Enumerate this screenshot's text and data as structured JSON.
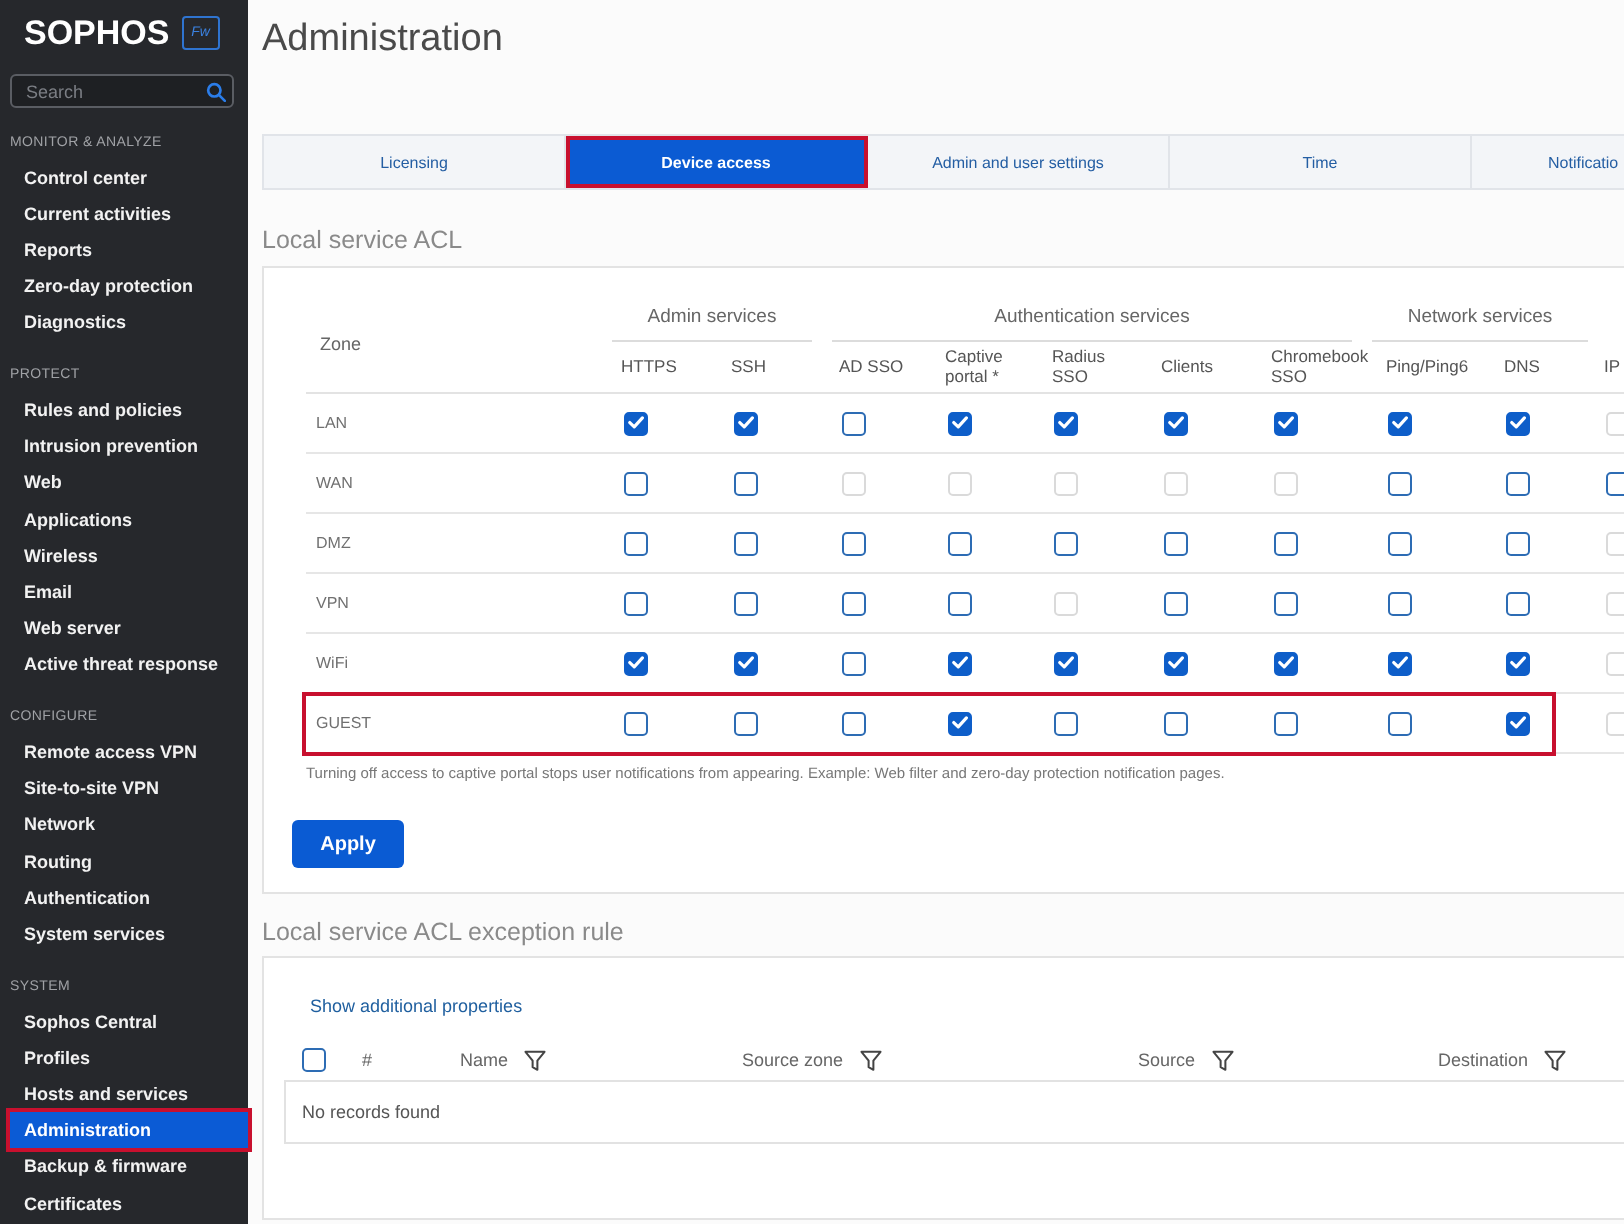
{
  "sidebar": {
    "logo": "SOPHOS",
    "badge": "Fw",
    "search": {
      "placeholder": "Search"
    },
    "sections": [
      {
        "title": "MONITOR & ANALYZE",
        "items": [
          {
            "label": "Control center",
            "selected": false,
            "highlighted": false
          },
          {
            "label": "Current activities",
            "selected": false,
            "highlighted": false
          },
          {
            "label": "Reports",
            "selected": false,
            "highlighted": false
          },
          {
            "label": "Zero-day protection",
            "selected": false,
            "highlighted": false
          },
          {
            "label": "Diagnostics",
            "selected": false,
            "highlighted": false
          }
        ]
      },
      {
        "title": "PROTECT",
        "items": [
          {
            "label": "Rules and policies",
            "selected": false,
            "highlighted": false
          },
          {
            "label": "Intrusion prevention",
            "selected": false,
            "highlighted": false
          },
          {
            "label": "Web",
            "selected": false,
            "highlighted": false
          },
          {
            "label": "Applications",
            "selected": false,
            "highlighted": false
          },
          {
            "label": "Wireless",
            "selected": false,
            "highlighted": false
          },
          {
            "label": "Email",
            "selected": false,
            "highlighted": false
          },
          {
            "label": "Web server",
            "selected": false,
            "highlighted": false
          },
          {
            "label": "Active threat response",
            "selected": false,
            "highlighted": false
          }
        ]
      },
      {
        "title": "CONFIGURE",
        "items": [
          {
            "label": "Remote access VPN",
            "selected": false,
            "highlighted": false
          },
          {
            "label": "Site-to-site VPN",
            "selected": false,
            "highlighted": false
          },
          {
            "label": "Network",
            "selected": false,
            "highlighted": false
          },
          {
            "label": "Routing",
            "selected": false,
            "highlighted": false
          },
          {
            "label": "Authentication",
            "selected": false,
            "highlighted": false
          },
          {
            "label": "System services",
            "selected": false,
            "highlighted": false
          }
        ]
      },
      {
        "title": "SYSTEM",
        "items": [
          {
            "label": "Sophos Central",
            "selected": false,
            "highlighted": false
          },
          {
            "label": "Profiles",
            "selected": false,
            "highlighted": false
          },
          {
            "label": "Hosts and services",
            "selected": false,
            "highlighted": false
          },
          {
            "label": "Administration",
            "selected": true,
            "highlighted": true
          },
          {
            "label": "Backup & firmware",
            "selected": false,
            "highlighted": false
          },
          {
            "label": "Certificates",
            "selected": false,
            "highlighted": false
          }
        ]
      }
    ]
  },
  "page_title": "Administration",
  "tabs": [
    {
      "label": "Licensing",
      "selected": false,
      "highlighted": false
    },
    {
      "label": "Device access",
      "selected": true,
      "highlighted": true
    },
    {
      "label": "Admin and user settings",
      "selected": false,
      "highlighted": false
    },
    {
      "label": "Time",
      "selected": false,
      "highlighted": false
    },
    {
      "label": "Notificatio",
      "selected": false,
      "highlighted": false
    }
  ],
  "acl": {
    "title": "Local service ACL",
    "zone_header": "Zone",
    "groups": [
      {
        "label": "Admin services",
        "columns": [
          "HTTPS",
          "SSH"
        ]
      },
      {
        "label": "Authentication services",
        "columns": [
          "AD SSO",
          "Captive portal *",
          "Radius SSO",
          "Clients",
          "Chromebook SSO"
        ]
      },
      {
        "label": "Network services",
        "columns": [
          "Ping/Ping6",
          "DNS"
        ]
      },
      {
        "columns": [
          "IP"
        ]
      }
    ],
    "zones": [
      {
        "name": "LAN",
        "highlighted": false,
        "cells": [
          {
            "checked": true,
            "disabled": false
          },
          {
            "checked": true,
            "disabled": false
          },
          {
            "checked": false,
            "disabled": false
          },
          {
            "checked": true,
            "disabled": false
          },
          {
            "checked": true,
            "disabled": false
          },
          {
            "checked": true,
            "disabled": false
          },
          {
            "checked": true,
            "disabled": false
          },
          {
            "checked": true,
            "disabled": false
          },
          {
            "checked": true,
            "disabled": false
          },
          {
            "checked": false,
            "disabled": true
          }
        ]
      },
      {
        "name": "WAN",
        "highlighted": false,
        "cells": [
          {
            "checked": false,
            "disabled": false
          },
          {
            "checked": false,
            "disabled": false
          },
          {
            "checked": false,
            "disabled": true
          },
          {
            "checked": false,
            "disabled": true
          },
          {
            "checked": false,
            "disabled": true
          },
          {
            "checked": false,
            "disabled": true
          },
          {
            "checked": false,
            "disabled": true
          },
          {
            "checked": false,
            "disabled": false
          },
          {
            "checked": false,
            "disabled": false
          },
          {
            "checked": false,
            "disabled": false
          }
        ]
      },
      {
        "name": "DMZ",
        "highlighted": false,
        "cells": [
          {
            "checked": false,
            "disabled": false
          },
          {
            "checked": false,
            "disabled": false
          },
          {
            "checked": false,
            "disabled": false
          },
          {
            "checked": false,
            "disabled": false
          },
          {
            "checked": false,
            "disabled": false
          },
          {
            "checked": false,
            "disabled": false
          },
          {
            "checked": false,
            "disabled": false
          },
          {
            "checked": false,
            "disabled": false
          },
          {
            "checked": false,
            "disabled": false
          },
          {
            "checked": false,
            "disabled": true
          }
        ]
      },
      {
        "name": "VPN",
        "highlighted": false,
        "cells": [
          {
            "checked": false,
            "disabled": false
          },
          {
            "checked": false,
            "disabled": false
          },
          {
            "checked": false,
            "disabled": false
          },
          {
            "checked": false,
            "disabled": false
          },
          {
            "checked": false,
            "disabled": true
          },
          {
            "checked": false,
            "disabled": false
          },
          {
            "checked": false,
            "disabled": false
          },
          {
            "checked": false,
            "disabled": false
          },
          {
            "checked": false,
            "disabled": false
          },
          {
            "checked": false,
            "disabled": true
          }
        ]
      },
      {
        "name": "WiFi",
        "highlighted": false,
        "cells": [
          {
            "checked": true,
            "disabled": false
          },
          {
            "checked": true,
            "disabled": false
          },
          {
            "checked": false,
            "disabled": false
          },
          {
            "checked": true,
            "disabled": false
          },
          {
            "checked": true,
            "disabled": false
          },
          {
            "checked": true,
            "disabled": false
          },
          {
            "checked": true,
            "disabled": false
          },
          {
            "checked": true,
            "disabled": false
          },
          {
            "checked": true,
            "disabled": false
          },
          {
            "checked": false,
            "disabled": true
          }
        ]
      },
      {
        "name": "GUEST",
        "highlighted": true,
        "cells": [
          {
            "checked": false,
            "disabled": false
          },
          {
            "checked": false,
            "disabled": false
          },
          {
            "checked": false,
            "disabled": false
          },
          {
            "checked": true,
            "disabled": false
          },
          {
            "checked": false,
            "disabled": false
          },
          {
            "checked": false,
            "disabled": false
          },
          {
            "checked": false,
            "disabled": false
          },
          {
            "checked": false,
            "disabled": false
          },
          {
            "checked": true,
            "disabled": false
          },
          {
            "checked": false,
            "disabled": true
          }
        ]
      }
    ],
    "note": "Turning off access to captive portal stops user notifications from appearing. Example: Web filter and zero-day protection notification pages.",
    "apply_button": "Apply"
  },
  "exceptions": {
    "title": "Local service ACL exception rule",
    "link": "Show additional properties",
    "select_all": {
      "checked": false
    },
    "columns": [
      {
        "label": "#",
        "filterable": false
      },
      {
        "label": "Name",
        "filterable": true
      },
      {
        "label": "Source zone",
        "filterable": true
      },
      {
        "label": "Source",
        "filterable": true
      },
      {
        "label": "Destination",
        "filterable": true
      }
    ],
    "empty_text": "No records found"
  }
}
